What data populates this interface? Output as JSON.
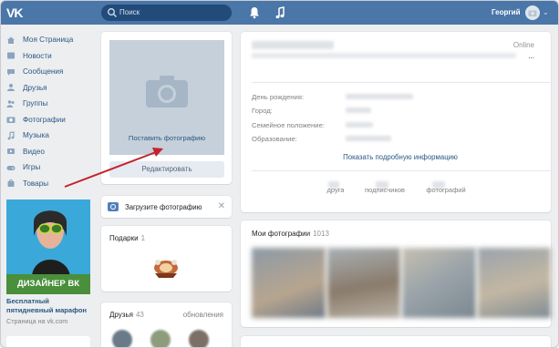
{
  "header": {
    "logo_text": "VK",
    "search_placeholder": "Поиск",
    "user_name": "Георгий",
    "user_chevron": "⌄"
  },
  "sidebar": {
    "items": [
      {
        "label": "Моя Страница",
        "icon": "home-icon"
      },
      {
        "label": "Новости",
        "icon": "news-icon"
      },
      {
        "label": "Сообщения",
        "icon": "messages-icon"
      },
      {
        "label": "Друзья",
        "icon": "friends-icon"
      },
      {
        "label": "Группы",
        "icon": "groups-icon"
      },
      {
        "label": "Фотографии",
        "icon": "camera-icon"
      },
      {
        "label": "Музыка",
        "icon": "music-icon"
      },
      {
        "label": "Видео",
        "icon": "video-icon"
      },
      {
        "label": "Игры",
        "icon": "gamepad-icon"
      },
      {
        "label": "Товары",
        "icon": "bag-icon"
      }
    ],
    "ad": {
      "banner_text": "ДИЗАЙНЕР ВК",
      "title": "Бесплатный пятидневный марафон",
      "source": "Страница на vk.com"
    }
  },
  "left_column": {
    "photo_placeholder_label": "Поставить фотографию",
    "edit_button": "Редактировать",
    "upload_prompt": "Загрузите фотографию",
    "upload_close": "✕",
    "gifts_title": "Подарки",
    "gifts_count": "1",
    "friends_title": "Друзья",
    "friends_count": "43",
    "friends_updates": "обновления"
  },
  "profile": {
    "status": "Online",
    "more_dots": "...",
    "fields": [
      {
        "label": "День рождения:"
      },
      {
        "label": "Город:"
      },
      {
        "label": "Семейное положение:"
      },
      {
        "label": "Образование:"
      }
    ],
    "more_info_link": "Показать подробную информацию",
    "stats": [
      {
        "label": "друга"
      },
      {
        "label": "подписчиков"
      },
      {
        "label": "фотографий"
      }
    ]
  },
  "my_photos": {
    "title": "Мои фотографии",
    "count": "1013"
  },
  "colors": {
    "header_bg": "#4a76a8",
    "link": "#2a5885",
    "arrow": "#c4222a",
    "ad_bar": "#4a8f3b"
  }
}
